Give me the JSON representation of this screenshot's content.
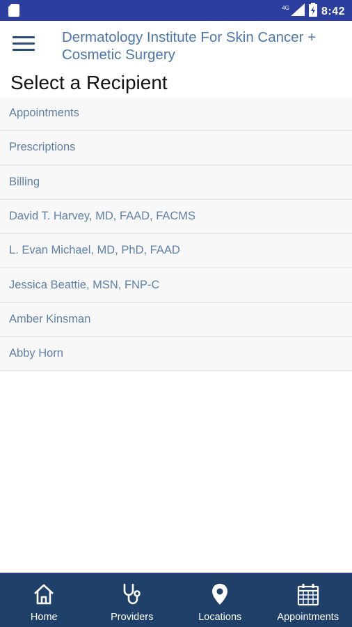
{
  "status_bar": {
    "time": "8:42",
    "network": "4G",
    "icons": [
      "sim-card-icon",
      "signal-icon",
      "battery-icon"
    ]
  },
  "header": {
    "menu_icon": "hamburger-menu-icon",
    "title": "Dermatology Institute For Skin Cancer + Cosmetic Surgery"
  },
  "page": {
    "title": "Select a Recipient"
  },
  "recipients": [
    "Appointments",
    "Prescriptions",
    "Billing",
    "David T. Harvey, MD, FAAD, FACMS",
    "L. Evan Michael, MD, PhD, FAAD",
    "Jessica Beattie, MSN, FNP-C",
    "Amber Kinsman",
    "Abby Horn"
  ],
  "bottom_nav": [
    {
      "label": "Home",
      "icon": "home-icon"
    },
    {
      "label": "Providers",
      "icon": "stethoscope-icon"
    },
    {
      "label": "Locations",
      "icon": "location-pin-icon"
    },
    {
      "label": "Appointments",
      "icon": "calendar-icon"
    }
  ],
  "colors": {
    "status_bar": "#2c3e9e",
    "title_blue": "#4c76ad",
    "list_text": "#5f80a8",
    "nav_bg": "#1f4068"
  }
}
